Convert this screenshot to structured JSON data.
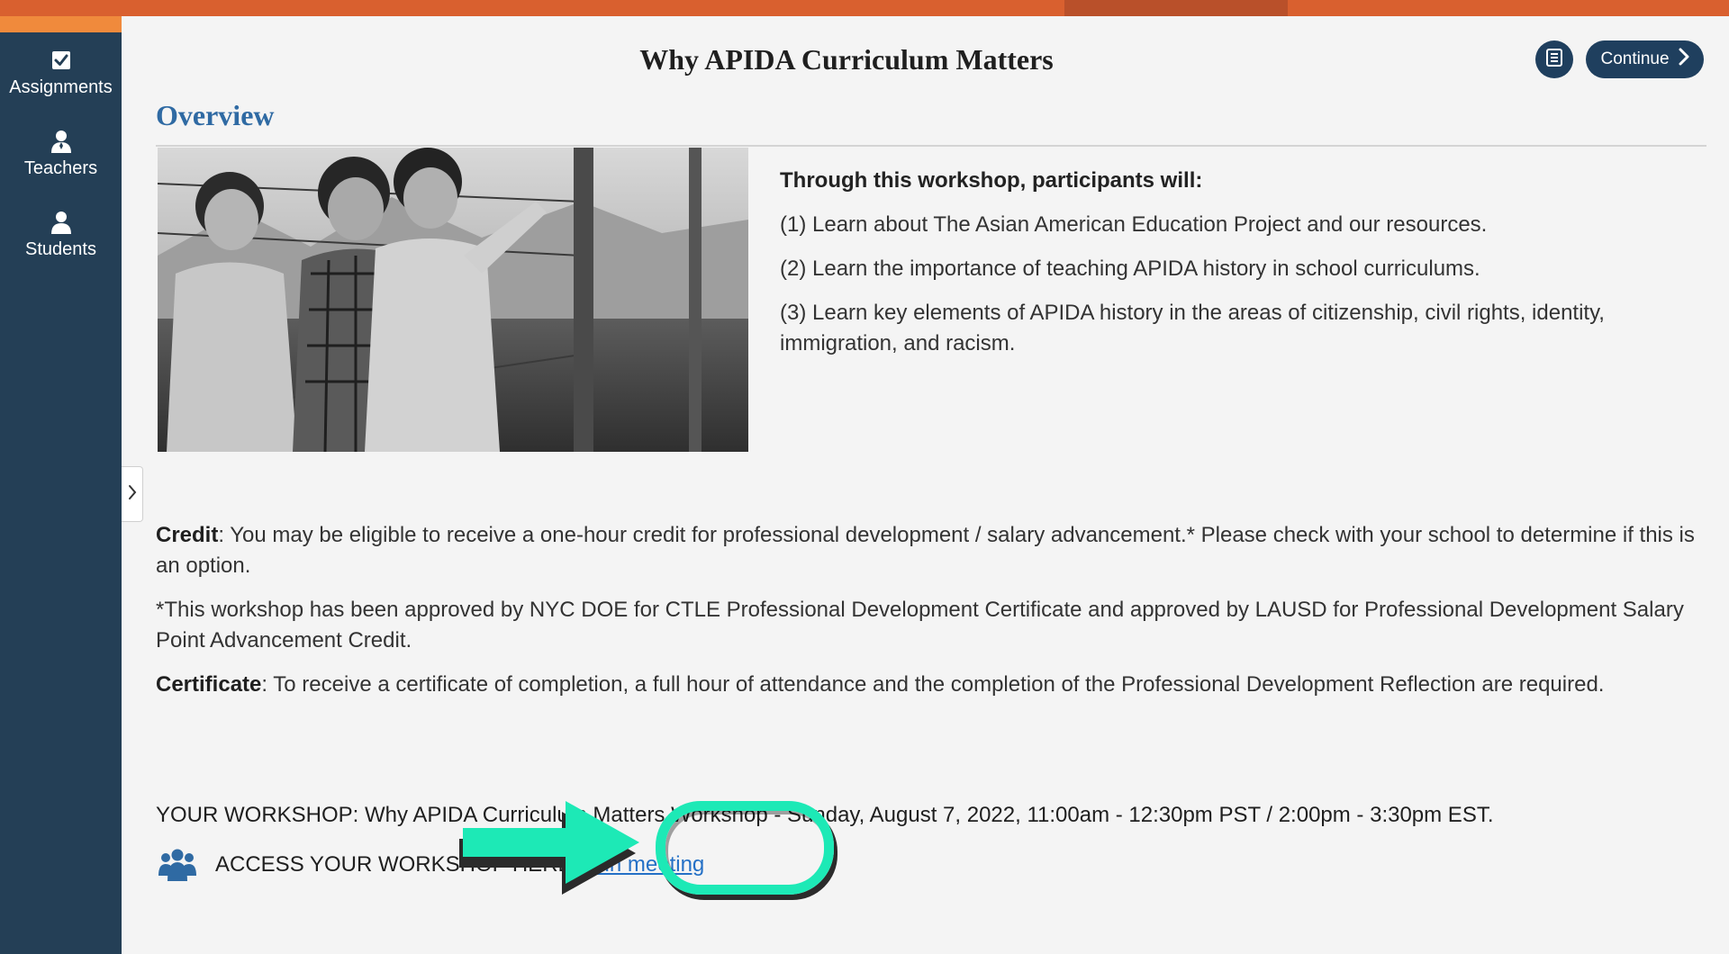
{
  "sidebar": {
    "items": [
      {
        "label": "Assignments",
        "icon": "checkbox-icon"
      },
      {
        "label": "Teachers",
        "icon": "person-icon"
      },
      {
        "label": "Students",
        "icon": "person-icon"
      }
    ]
  },
  "header": {
    "title": "Why APIDA Curriculum Matters",
    "continue_label": "Continue",
    "icon_button": "notebook-icon"
  },
  "overview": {
    "heading": "Overview",
    "goals_lead": "Through this workshop, participants will:",
    "goals": [
      "(1) Learn about The Asian American Education Project and our resources.",
      "(2) Learn the importance of teaching APIDA history in school curriculums.",
      "(3) Learn key elements of APIDA history in the areas of citizenship, civil rights, identity, immigration, and racism."
    ]
  },
  "credit": {
    "label": "Credit",
    "text": ": You may be eligible to receive a one-hour credit for professional development / salary advancement.* Please check with your school to determine if this is an option."
  },
  "approval_note": "*This workshop has been approved by NYC DOE for CTLE Professional Development Certificate and approved by LAUSD for Professional Development Salary Point Advancement Credit.",
  "certificate": {
    "label": "Certificate",
    "text": ": To receive a certificate of completion, a full hour of attendance and the completion of the Professional Development Reflection are required."
  },
  "workshop": {
    "line": "YOUR WORKSHOP: Why APIDA Curriculum Matters Workshop - Sunday, August 7, 2022, 11:00am - 12:30pm PST / 2:00pm - 3:30pm EST.",
    "access_label": "ACCESS YOUR WORKSHOP HERE:",
    "join_label": "Join meeting"
  },
  "colors": {
    "topbar": "#d9602f",
    "sidebar": "#243f56",
    "accent_blue": "#2f6aa3",
    "callout": "#1de9b6"
  }
}
